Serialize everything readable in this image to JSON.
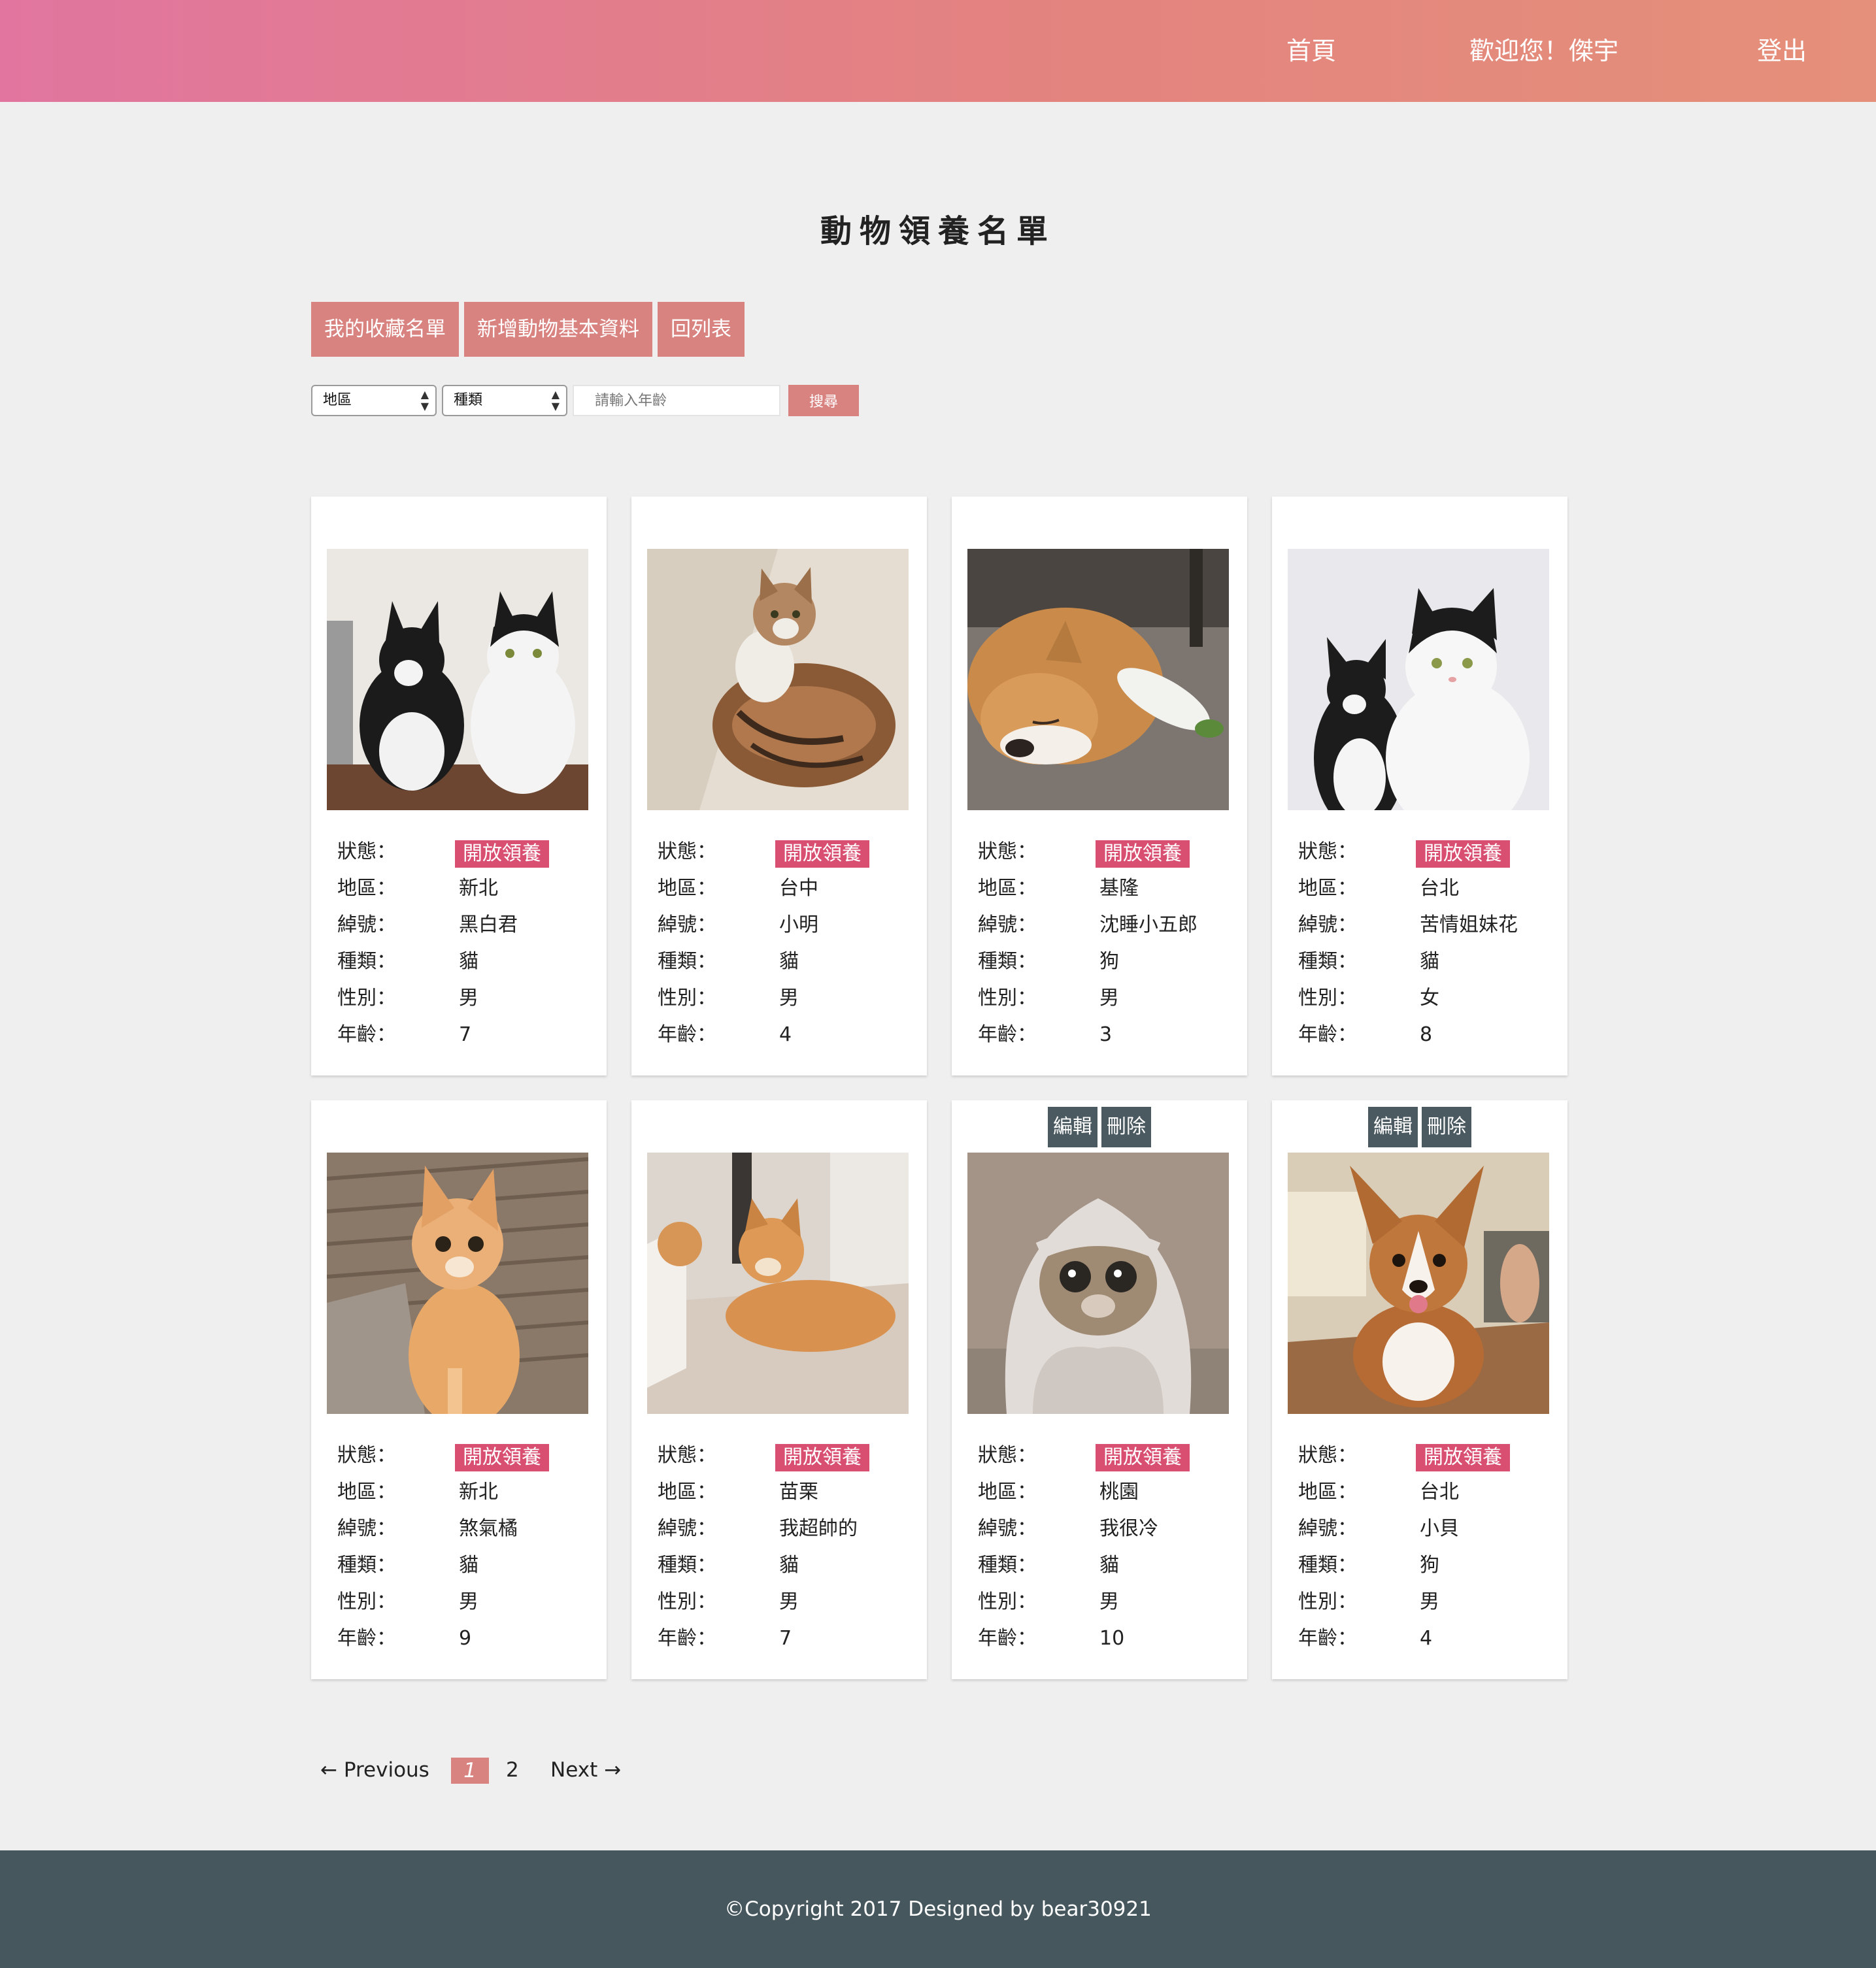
{
  "nav": {
    "home": "首頁",
    "welcome": "歡迎您！傑宇",
    "logout": "登出"
  },
  "page_title": "動物領養名單",
  "actions": {
    "favorites": "我的收藏名單",
    "add_animal": "新增動物基本資料",
    "back_to_list": "回列表"
  },
  "search": {
    "region_select": "地區",
    "type_select": "種類",
    "age_placeholder": "請輸入年齡",
    "search_button": "搜尋"
  },
  "labels": {
    "status": "狀態：",
    "region": "地區：",
    "nickname": "綽號：",
    "type": "種類：",
    "gender": "性別：",
    "age": "年齡："
  },
  "card_tools": {
    "edit": "編輯",
    "delete": "刪除"
  },
  "animals": [
    {
      "status": "開放領養",
      "region": "新北",
      "nickname": "黑白君",
      "type": "貓",
      "gender": "男",
      "age": "7",
      "photo": "two-tuxedo-cats"
    },
    {
      "status": "開放領養",
      "region": "台中",
      "nickname": "小明",
      "type": "貓",
      "gender": "男",
      "age": "4",
      "photo": "tabby-cat-lying"
    },
    {
      "status": "開放領養",
      "region": "基隆",
      "nickname": "沈睡小五郎",
      "type": "狗",
      "gender": "男",
      "age": "3",
      "photo": "sleeping-shiba-dog"
    },
    {
      "status": "開放領養",
      "region": "台北",
      "nickname": "苦情姐妹花",
      "type": "貓",
      "gender": "女",
      "age": "8",
      "photo": "two-black-white-cats"
    },
    {
      "status": "開放領養",
      "region": "新北",
      "nickname": "煞氣橘",
      "type": "貓",
      "gender": "男",
      "age": "9",
      "photo": "orange-cat-on-deck"
    },
    {
      "status": "開放領養",
      "region": "苗栗",
      "nickname": "我超帥的",
      "type": "貓",
      "gender": "男",
      "age": "7",
      "photo": "orange-cats-indoor"
    },
    {
      "status": "開放領養",
      "region": "桃園",
      "nickname": "我很冷",
      "type": "貓",
      "gender": "男",
      "age": "10",
      "photo": "cat-in-towel"
    },
    {
      "status": "開放領養",
      "region": "台北",
      "nickname": "小貝",
      "type": "狗",
      "gender": "男",
      "age": "4",
      "photo": "corgi-puppy"
    }
  ],
  "pagination": {
    "previous": "← Previous",
    "page1": "1",
    "page2": "2",
    "next": "Next →"
  },
  "footer": "©Copyright 2017 Designed by bear30921",
  "colors": {
    "header_start": "#e1759f",
    "header_end": "#e5907a",
    "accent_button": "#d98381",
    "status_badge": "#d94f72",
    "dark_button": "#4b5a61",
    "footer": "#46575e"
  }
}
